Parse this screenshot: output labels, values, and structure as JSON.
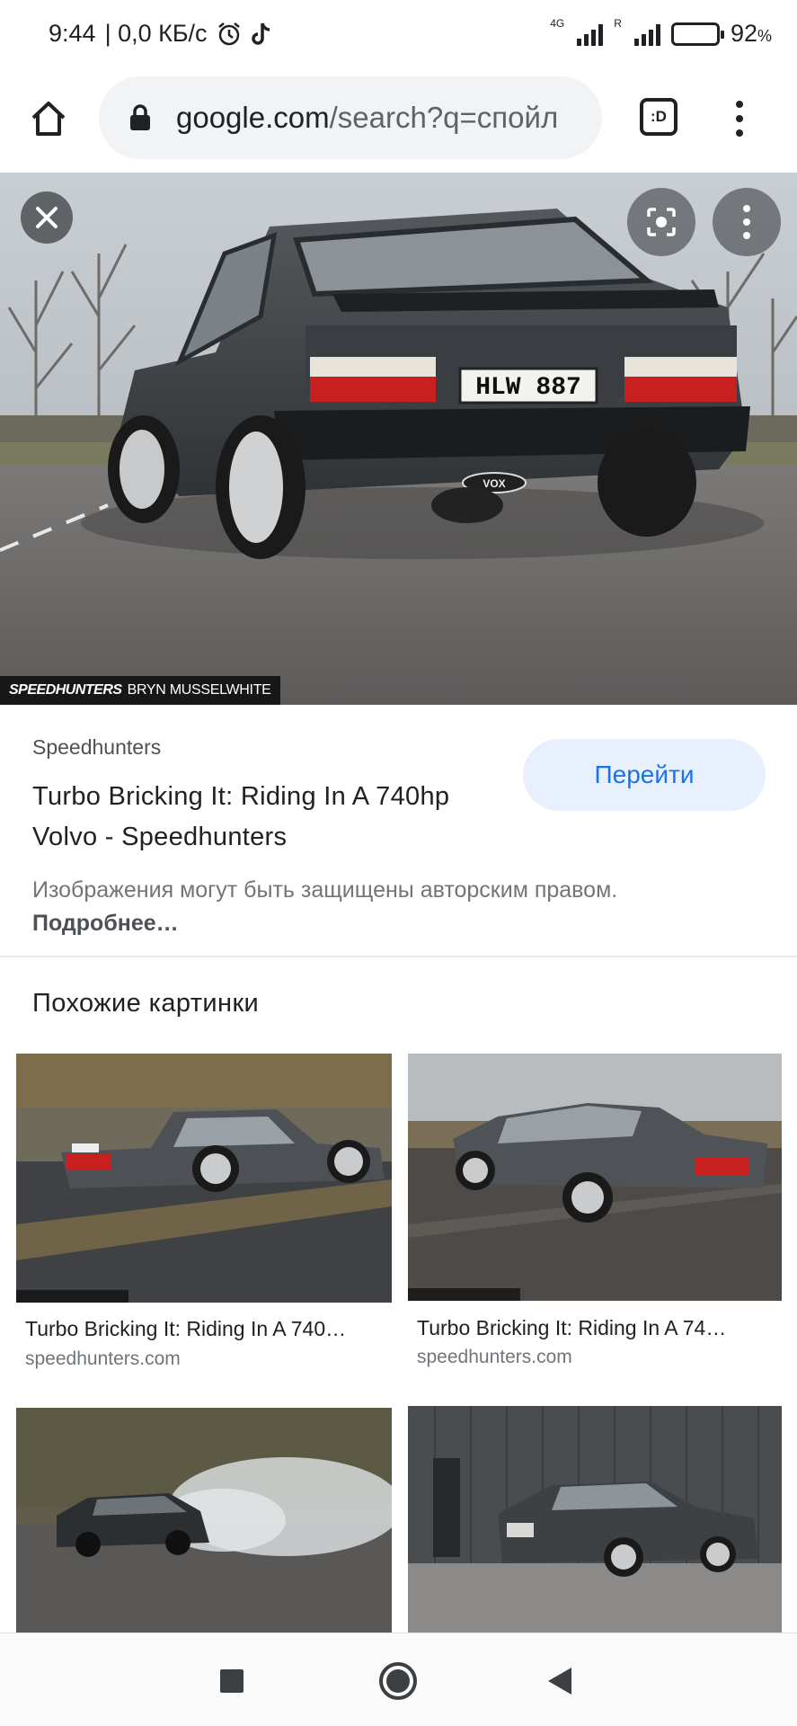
{
  "status_bar": {
    "time": "9:44",
    "net_speed": "| 0,0 КБ/с",
    "net_type": "4G",
    "roaming": "R",
    "battery": "92",
    "battery_unit": "%"
  },
  "browser": {
    "url_host": "google.com",
    "url_path": "/search?q=спойл",
    "tabs_label": ":D"
  },
  "hero": {
    "credit_brand": "SPEEDHUNTERS",
    "credit_author": "BRYN MUSSELWHITE",
    "plate": "HLW 887",
    "badge": "VOX"
  },
  "result": {
    "source": "Speedhunters",
    "title": "Turbo Bricking It: Riding In A 740hp Volvo - Speedhunters",
    "visit_label": "Перейти",
    "notice_text": "Изображения могут быть защищены авторским правом.",
    "notice_link": "Подробнее…"
  },
  "similar": {
    "heading": "Похожие картинки",
    "items": [
      {
        "title": "Turbo Bricking It: Riding In A 740…",
        "site": "speedhunters.com"
      },
      {
        "title": "Turbo Bricking It: Riding In A 74…",
        "site": "speedhunters.com"
      },
      {
        "title": "",
        "site": ""
      },
      {
        "title": "",
        "site": ""
      }
    ]
  },
  "colors": {
    "accent": "#1a73e8",
    "visit_bg": "#e8f0fe",
    "car_grey": "#3e4246"
  }
}
